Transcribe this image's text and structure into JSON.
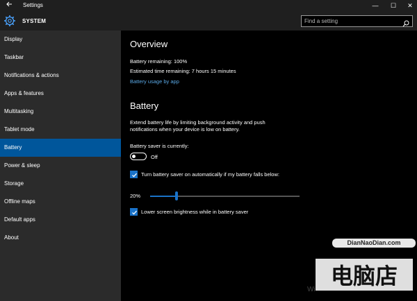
{
  "window": {
    "title": "Settings",
    "back_icon": "back-arrow-icon",
    "minimize_glyph": "—",
    "maximize_glyph": "☐",
    "close_glyph": "✕"
  },
  "header": {
    "icon": "gear-icon",
    "section": "SYSTEM",
    "search_placeholder": "Find a setting"
  },
  "sidebar": {
    "items": [
      {
        "label": "Display"
      },
      {
        "label": "Taskbar"
      },
      {
        "label": "Notifications & actions"
      },
      {
        "label": "Apps & features"
      },
      {
        "label": "Multitasking"
      },
      {
        "label": "Tablet mode"
      },
      {
        "label": "Battery",
        "active": true
      },
      {
        "label": "Power & sleep"
      },
      {
        "label": "Storage"
      },
      {
        "label": "Offline maps"
      },
      {
        "label": "Default apps"
      },
      {
        "label": "About"
      }
    ]
  },
  "overview": {
    "heading": "Overview",
    "remaining": "Battery remaining: 100%",
    "estimated": "Estimated time remaining: 7 hours 15 minutes",
    "usage_link": "Battery usage by app"
  },
  "battery": {
    "heading": "Battery",
    "desc_line1": "Extend battery life by limiting background activity and push",
    "desc_line2": "notifications when your device is low on battery.",
    "saver_label": "Battery saver is currently:",
    "toggle_state": "Off",
    "auto_on_label": "Turn battery saver on automatically if my battery falls below:",
    "auto_on_checked": true,
    "threshold_label": "20%",
    "threshold_value": 20,
    "lower_brightness_label": "Lower screen brightness while in battery saver",
    "lower_brightness_checked": true
  },
  "watermark": {
    "url": "DianNaoDian.com",
    "brand": "电脑店",
    "os_text": "Wi"
  },
  "colors": {
    "accent": "#1a73c9",
    "active_nav": "#00569b",
    "sidebar_bg": "#2b2b2b",
    "link": "#5aa9e6"
  }
}
